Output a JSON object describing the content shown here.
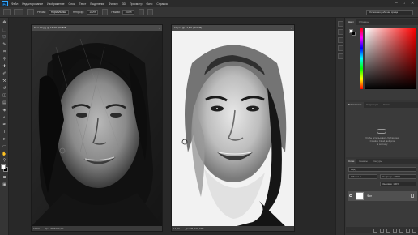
{
  "app": {
    "logo": "Ps"
  },
  "menu": [
    "Файл",
    "Редактирование",
    "Изображение",
    "Слои",
    "Текст",
    "Выделение",
    "Фильтр",
    "3D",
    "Просмотр",
    "Окно",
    "Справка"
  ],
  "window_controls": {
    "minimize": "–",
    "maximize": "□",
    "close": "✕"
  },
  "options": {
    "mode_label": "Режим:",
    "mode_value": "Нормальный",
    "opacity_label": "Непрозр.:",
    "opacity_value": "100%",
    "flow_label": "Нажим:",
    "flow_value": "100%",
    "workspace": "Основная рабочая среда"
  },
  "documents": [
    {
      "title": "Тест 10.jpg @ 16,4% (RGB/8)",
      "zoom": "16,4%",
      "status": "Док: 26,3M/26,3M"
    },
    {
      "title": "10.psd @ 14,8% (RGB/8)",
      "zoom": "14,8%",
      "status": "Док: 38,5M/3,18M"
    }
  ],
  "color_panel": {
    "tabs": [
      "Цвет",
      "Образцы"
    ],
    "fg_color": "#ffffff",
    "bg_color": "#000000"
  },
  "libraries_panel": {
    "tabs": [
      "Библиотеки",
      "Коррекция",
      "Стили"
    ],
    "message_1": "Чтобы использовать библиотеки",
    "message_2": "Creative Cloud, войдите",
    "message_3": "в систему"
  },
  "layers_panel": {
    "tabs": [
      "Слои",
      "Каналы",
      "Контуры"
    ],
    "filter_label": "Вид",
    "blend_value": "Обычные",
    "opacity_label": "Непрозр.: 100%",
    "fill_label": "Заливка: 100%",
    "layers": [
      {
        "name": "Фон",
        "visible": true,
        "locked": true
      }
    ]
  }
}
